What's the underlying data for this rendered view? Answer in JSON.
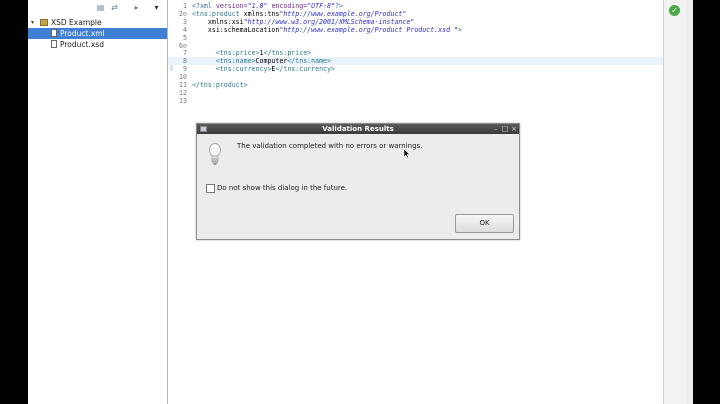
{
  "explorer": {
    "tree": [
      {
        "label": "XSD Example",
        "kind": "project",
        "expanded": true
      },
      {
        "label": "Product.xml",
        "kind": "file",
        "selected": true
      },
      {
        "label": "Product.xsd",
        "kind": "file",
        "selected": false
      }
    ]
  },
  "editor": {
    "lines": [
      {
        "n": "1",
        "t": "<?xml version=\"1.0\" encoding=\"UTF-8\"?>"
      },
      {
        "n": "2⊖",
        "t": "<tns:product xmlns:tns=\"http://www.example.org/Product\""
      },
      {
        "n": "3",
        "t": "    xmlns:xsi=\"http://www.w3.org/2001/XMLSchema-instance\""
      },
      {
        "n": "4",
        "t": "    xsi:schemaLocation=\"http://www.example.org/Product Product.xsd \">"
      },
      {
        "n": "5",
        "t": ""
      },
      {
        "n": "6⊖",
        "t": ""
      },
      {
        "n": "7",
        "t": "      <tns:price>1</tns:price>"
      },
      {
        "n": "8",
        "t": "      <tns:name>Computer</tns:name>"
      },
      {
        "n": "9",
        "t": "      <tns:currency>E</tns:currency>"
      },
      {
        "n": "10",
        "t": ""
      },
      {
        "n": "11",
        "t": "</tns:product>"
      },
      {
        "n": "12",
        "t": ""
      },
      {
        "n": "13",
        "t": ""
      }
    ]
  },
  "dialog": {
    "title": "Validation Results",
    "message": "The validation completed with no errors or warnings.",
    "checkbox_label": "Do not show this dialog in the future.",
    "checkbox_checked": false,
    "ok_label": "OK",
    "controls": [
      "–",
      "□",
      "×"
    ]
  },
  "icons": {
    "toolbar": [
      "collapse-all-icon",
      "link-editor-icon",
      "view-menu-icon",
      "chevron-down-icon"
    ],
    "validate": "check-icon",
    "info": "lightbulb-icon"
  },
  "colors": {
    "selection": "#3f7fd4",
    "dialog_title_bar": "#4a4a4a"
  }
}
